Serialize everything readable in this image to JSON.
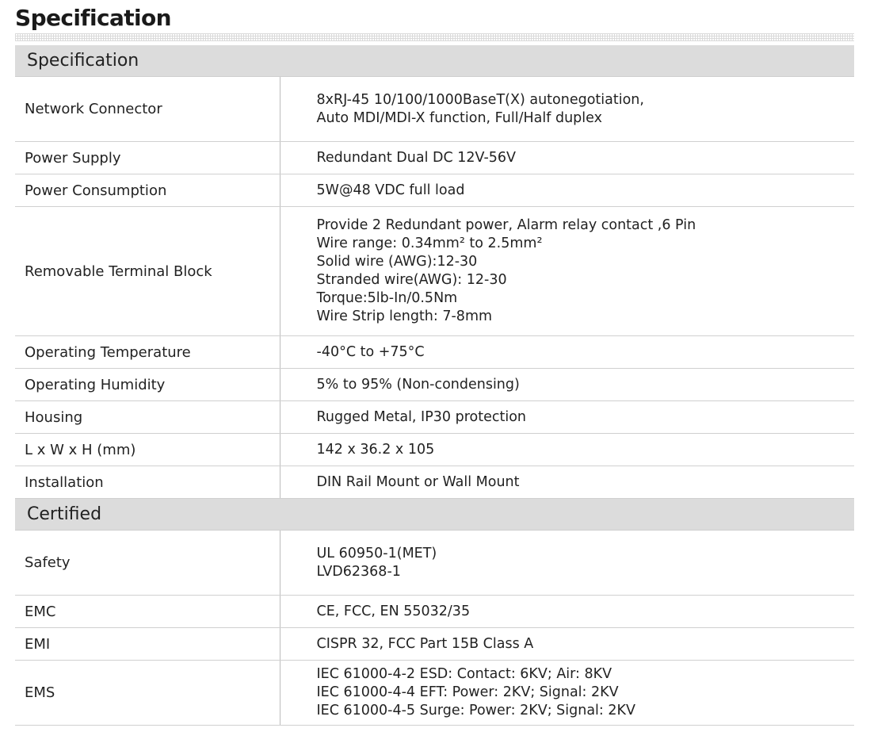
{
  "page_title": "Specification",
  "sections": [
    {
      "title": "Specification",
      "rows": [
        {
          "label": "Network Connector",
          "lines": [
            "8xRJ-45 10/100/1000BaseT(X) autonegotiation,",
            "Auto MDI/MDI-X function, Full/Half duplex"
          ]
        },
        {
          "label": "Power Supply",
          "lines": [
            "Redundant Dual DC 12V-56V"
          ]
        },
        {
          "label": "Power Consumption",
          "lines": [
            "5W@48 VDC full load"
          ]
        },
        {
          "label": "Removable Terminal Block",
          "lines": [
            "Provide 2 Redundant power, Alarm relay contact ,6 Pin",
            "Wire range: 0.34mm² to 2.5mm²",
            "Solid wire (AWG):12-30",
            "Stranded wire(AWG): 12-30",
            "Torque:5lb-In/0.5Nm",
            "Wire Strip length: 7-8mm"
          ]
        },
        {
          "label": "Operating Temperature",
          "lines": [
            "-40°C to +75°C"
          ]
        },
        {
          "label": "Operating Humidity",
          "lines": [
            "5% to 95% (Non-condensing)"
          ]
        },
        {
          "label": "Housing",
          "lines": [
            "Rugged Metal, IP30 protection"
          ]
        },
        {
          "label": "L x W x H (mm)",
          "lines": [
            "142 x 36.2 x 105"
          ]
        },
        {
          "label": "Installation",
          "lines": [
            "DIN Rail Mount or Wall Mount"
          ]
        }
      ]
    },
    {
      "title": "Certified",
      "rows": [
        {
          "label": "Safety",
          "lines": [
            "UL 60950-1(MET)",
            "LVD62368-1"
          ]
        },
        {
          "label": "EMC",
          "lines": [
            "CE, FCC, EN 55032/35"
          ]
        },
        {
          "label": "EMI",
          "lines": [
            "CISPR 32, FCC Part 15B Class A"
          ]
        },
        {
          "label": "EMS",
          "lines": [
            "IEC 61000-4-2 ESD: Contact: 6KV; Air: 8KV",
            "IEC 61000-4-4 EFT: Power: 2KV; Signal: 2KV",
            "IEC 61000-4-5 Surge: Power: 2KV; Signal: 2KV"
          ]
        }
      ]
    }
  ]
}
